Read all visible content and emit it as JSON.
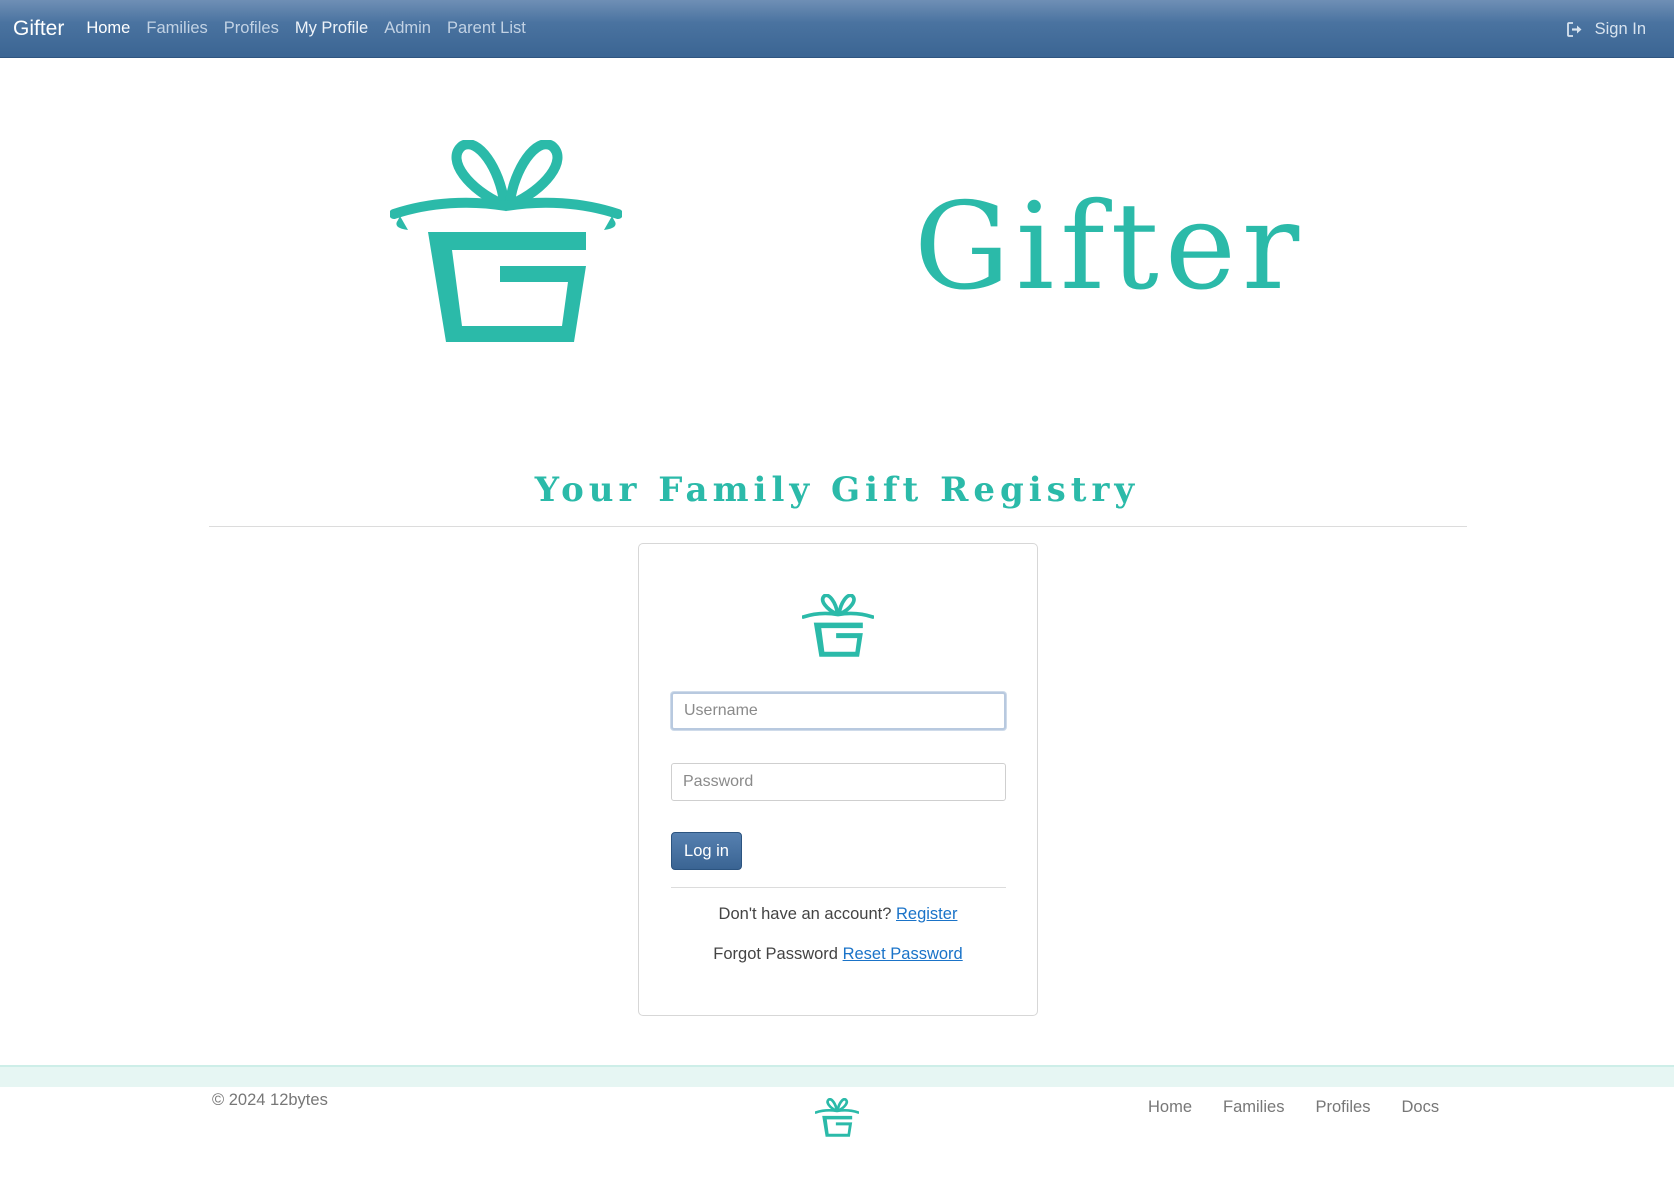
{
  "navbar": {
    "brand": "Gifter",
    "links": [
      "Home",
      "Families",
      "Profiles",
      "My Profile",
      "Admin",
      "Parent List"
    ],
    "signin": "Sign In",
    "signin_icon": "sign-in-icon"
  },
  "hero": {
    "logo_icon": "gift-g-icon",
    "title": "Gifter",
    "tagline": "Your Family Gift Registry"
  },
  "login": {
    "username_placeholder": "Username",
    "username_value": "",
    "password_placeholder": "Password",
    "password_value": "",
    "button": "Log in",
    "register_prompt": "Don't have an account?",
    "register_link": "Register",
    "forgot_prompt": "Forgot Password",
    "reset_link": "Reset Password"
  },
  "footer": {
    "copyright": "© 2024 12bytes",
    "links": [
      "Home",
      "Families",
      "Profiles",
      "Docs"
    ]
  },
  "colors": {
    "brand_teal": "#2bbaa9",
    "navbar_blue": "#4a73a0",
    "link_blue": "#1a73c8"
  }
}
